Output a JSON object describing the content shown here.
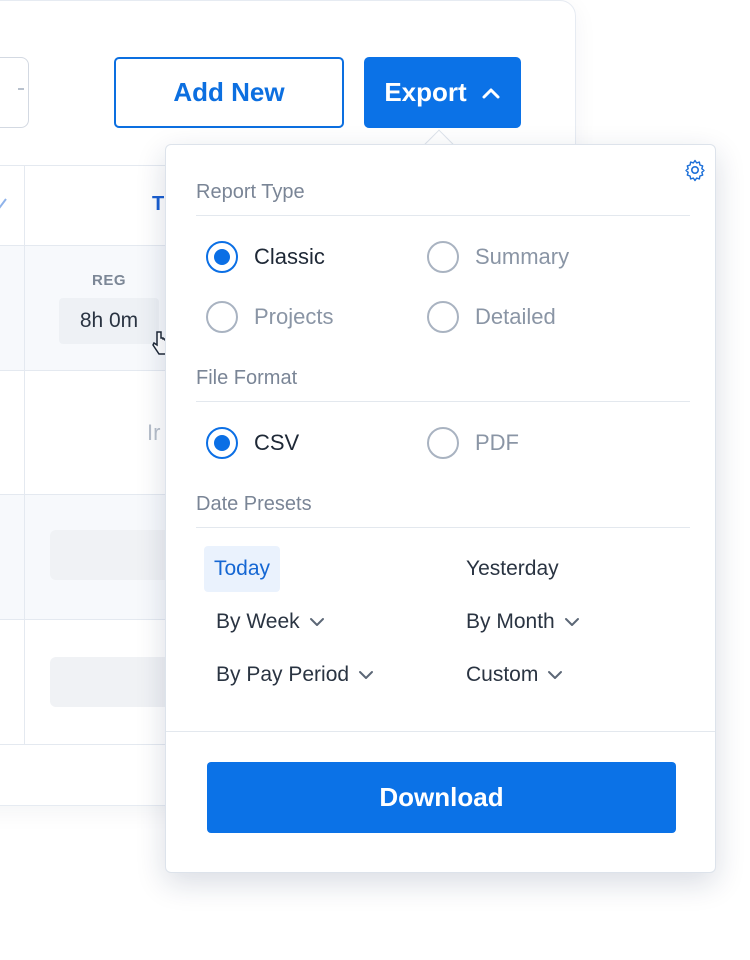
{
  "toolbar": {
    "add_new_label": "Add New",
    "export_label": "Export"
  },
  "table": {
    "header_partial": "T",
    "reg_label": "REG",
    "reg_value": "8h 0m",
    "partial_text": "Ir"
  },
  "export_menu": {
    "report_type": {
      "title": "Report Type",
      "options": [
        {
          "label": "Classic",
          "checked": true
        },
        {
          "label": "Summary",
          "checked": false
        },
        {
          "label": "Projects",
          "checked": false
        },
        {
          "label": "Detailed",
          "checked": false
        }
      ]
    },
    "file_format": {
      "title": "File Format",
      "options": [
        {
          "label": "CSV",
          "checked": true
        },
        {
          "label": "PDF",
          "checked": false
        }
      ]
    },
    "date_presets": {
      "title": "Date Presets",
      "items": [
        {
          "label": "Today",
          "active": true
        },
        {
          "label": "Yesterday",
          "active": false
        },
        {
          "label": "By Week",
          "dropdown": true
        },
        {
          "label": "By Month",
          "dropdown": true
        },
        {
          "label": "By Pay Period",
          "dropdown": true
        },
        {
          "label": "Custom",
          "dropdown": true
        }
      ]
    },
    "download_label": "Download"
  },
  "colors": {
    "primary": "#0b72e7",
    "primary_text": "#0c6fe0",
    "active_bg": "#eaf2fd"
  },
  "icons": {
    "export_chevron": "chevron-up-icon",
    "settings": "gear-icon",
    "dropdown": "chevron-down-icon"
  }
}
